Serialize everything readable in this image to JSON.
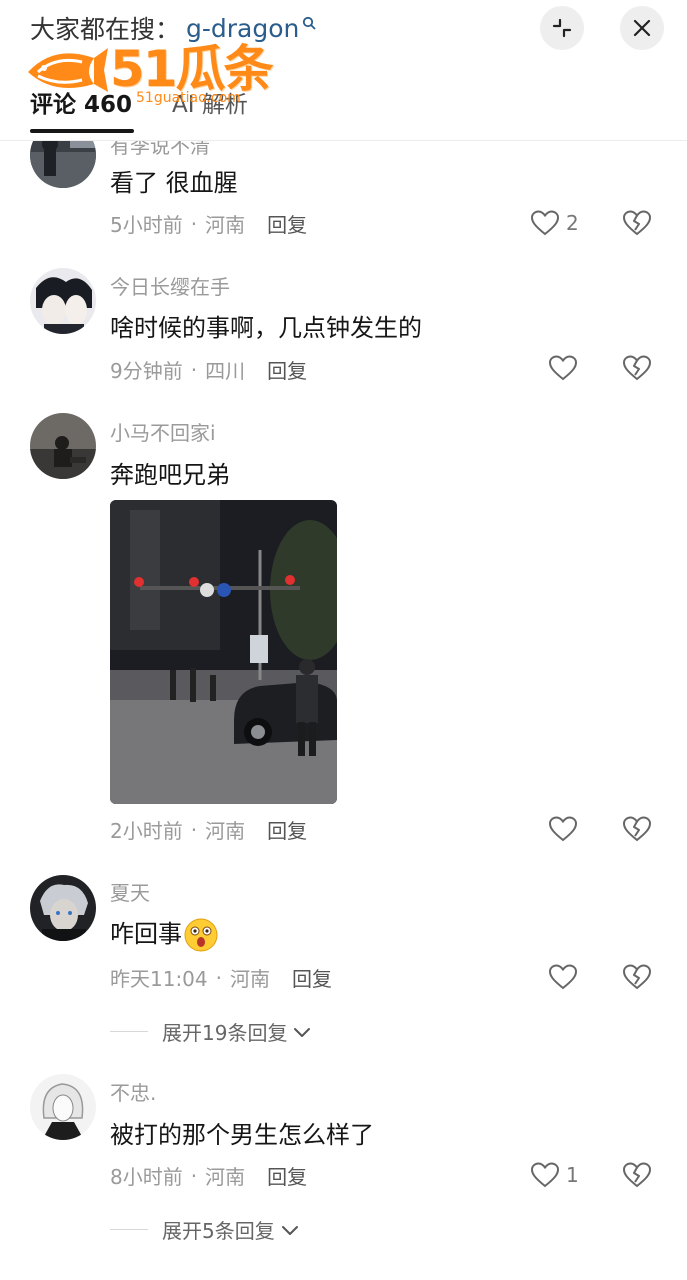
{
  "header": {
    "search_prefix": "大家都在搜：",
    "search_term": "g-dragon",
    "tabs": [
      {
        "label": "评论 460"
      },
      {
        "label": "AI 解析"
      }
    ]
  },
  "watermark": {
    "brand": "51瓜条",
    "url": "51guatiao.com"
  },
  "comments": [
    {
      "username": "有李说不清",
      "text": "看了 很血腥",
      "time": "5小时前",
      "location": "河南",
      "reply": "回复",
      "likes": "2"
    },
    {
      "username": "今日长缨在手",
      "text": "啥时候的事啊，几点钟发生的",
      "time": "9分钟前",
      "location": "四川",
      "reply": "回复",
      "likes": ""
    },
    {
      "username": "小马不回家i",
      "text": "奔跑吧兄弟",
      "time": "2小时前",
      "location": "河南",
      "reply": "回复",
      "likes": ""
    },
    {
      "username": "夏天",
      "text": "咋回事",
      "time": "昨天11:04",
      "location": "河南",
      "reply": "回复",
      "likes": "",
      "expand": "展开19条回复"
    },
    {
      "username": "不忠.",
      "text": "被打的那个男生怎么样了",
      "time": "8小时前",
      "location": "河南",
      "reply": "回复",
      "likes": "1",
      "expand": "展开5条回复"
    }
  ],
  "icons": {
    "search": "search-icon",
    "collapse": "collapse-icon",
    "close": "close-icon",
    "like": "heart-icon",
    "dislike": "broken-heart-icon",
    "chevron": "chevron-down-icon",
    "emoji": "surprised-emoji-icon"
  },
  "colors": {
    "search_term": "#2a5d8c",
    "watermark": "#ff8a18",
    "meta_text": "#9a9a9a"
  }
}
